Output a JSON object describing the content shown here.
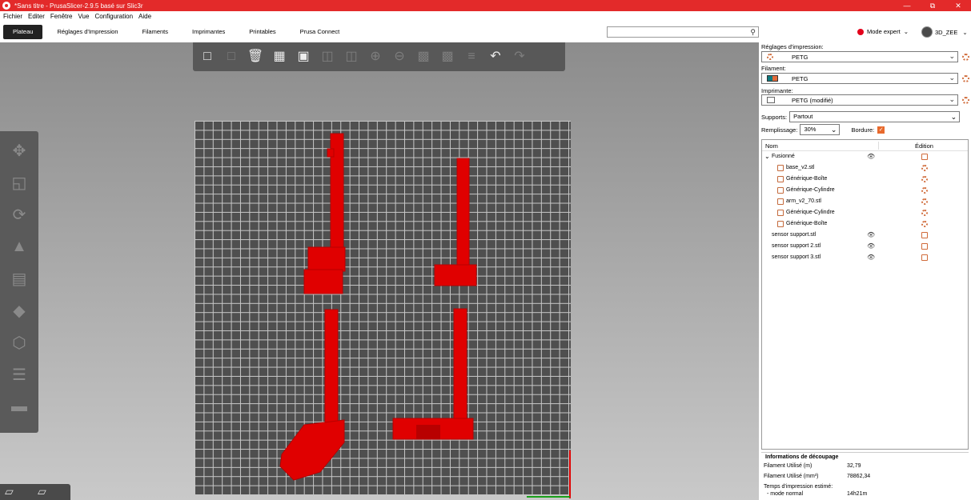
{
  "window": {
    "title": "*Sans titre - PrusaSlicer-2.9.5 basé sur Slic3r",
    "minimize": "—",
    "maximize": "⧉",
    "close": "✕"
  },
  "menu": [
    "Fichier",
    "Editer",
    "Fenêtre",
    "Vue",
    "Configuration",
    "Aide"
  ],
  "tabs": [
    "Plateau",
    "Réglages d'Impression",
    "Filaments",
    "Imprimantes",
    "Printables",
    "Prusa Connect"
  ],
  "search": {
    "placeholder": ""
  },
  "mode": {
    "label": "Mode expert",
    "color": "#e3001b"
  },
  "user": {
    "name": "3D_ZEE"
  },
  "sidebar": {
    "print_settings": {
      "label": "Réglages d'impression:",
      "value": "PETG"
    },
    "filament": {
      "label": "Filament:",
      "value": "PETG"
    },
    "printer": {
      "label": "Imprimante:",
      "value": "PETG (modifié)"
    },
    "supports": {
      "label": "Supports:",
      "value": "Partout"
    },
    "infill": {
      "label": "Remplissage:",
      "value": "30%"
    },
    "brim": {
      "label": "Bordure:",
      "checked": true
    }
  },
  "object_list": {
    "col_name": "Nom",
    "col_edit": "Édition",
    "items": [
      {
        "name": "Fusionné",
        "level": 0,
        "expanded": true,
        "visible": true
      },
      {
        "name": "base_v2.stl",
        "level": 1
      },
      {
        "name": "Générique-Boîte",
        "level": 1
      },
      {
        "name": "Générique-Cylindre",
        "level": 1
      },
      {
        "name": "arm_v2_70.stl",
        "level": 1
      },
      {
        "name": "Générique-Cylindre",
        "level": 1
      },
      {
        "name": "Générique-Boîte",
        "level": 1
      },
      {
        "name": "sensor support.stl",
        "level": 0,
        "visible": true
      },
      {
        "name": "sensor support 2.stl",
        "level": 0,
        "visible": true
      },
      {
        "name": "sensor support 3.stl",
        "level": 0,
        "visible": true
      }
    ]
  },
  "slice_info": {
    "title": "Informations de découpage",
    "filament_m_label": "Filament Utilisé (m)",
    "filament_m_value": "32,79",
    "filament_mm3_label": "Filament Utilisé (mm³)",
    "filament_mm3_value": "78862,34",
    "time_label": "Temps d'impression estimé:",
    "mode_label": "- mode normal",
    "mode_value": "14h21m"
  },
  "colors": {
    "accent": "#e86a2d",
    "titlebar": "#e32a2a",
    "model": "#e00000"
  }
}
